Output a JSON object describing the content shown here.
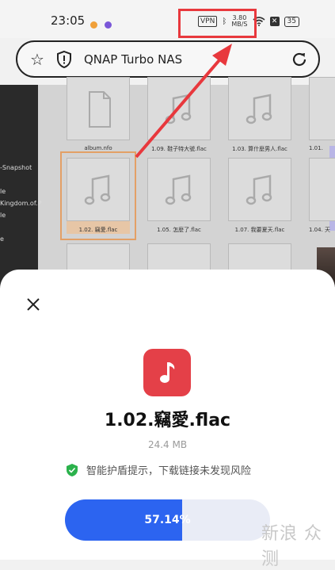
{
  "status_bar": {
    "time": "23:05",
    "vpn": "VPN",
    "speed_value": "3.80",
    "speed_unit": "MB/S",
    "battery": "35",
    "dot_colors": [
      "#f0a03a",
      "#7a57d8"
    ]
  },
  "url_bar": {
    "title": "QNAP Turbo NAS"
  },
  "sidebar": {
    "items": [
      "-Snapshot",
      "le",
      "Kingdom.of.P",
      "le",
      "e"
    ]
  },
  "file_grid": {
    "items": [
      {
        "name": "album.nfo",
        "icon": "document-icon"
      },
      {
        "name": "1.09. 鞋子特大號.flac",
        "icon": "music-note-icon"
      },
      {
        "name": "1.03. 算什麼男人.flac",
        "icon": "music-note-icon"
      },
      {
        "name": "1.01.",
        "icon": "music-note-icon"
      },
      {
        "name": "1.02. 竊愛.flac",
        "icon": "music-note-icon",
        "selected": true
      },
      {
        "name": "1.05. 怎麼了.flac",
        "icon": "music-note-icon"
      },
      {
        "name": "1.07. 我要夏天.flac",
        "icon": "music-note-icon"
      },
      {
        "name": "1.04. 天",
        "icon": "music-note-icon"
      }
    ]
  },
  "download_sheet": {
    "file_name": "1.02.竊愛.flac",
    "file_size": "24.4 MB",
    "safety_text": "智能护盾提示，下载链接未发现风险",
    "progress_percent": 57.14,
    "progress_label": "57.14%",
    "accent_color": "#2c64f0",
    "app_icon_color": "#e44048"
  },
  "watermark": {
    "text": "新浪 众测"
  }
}
